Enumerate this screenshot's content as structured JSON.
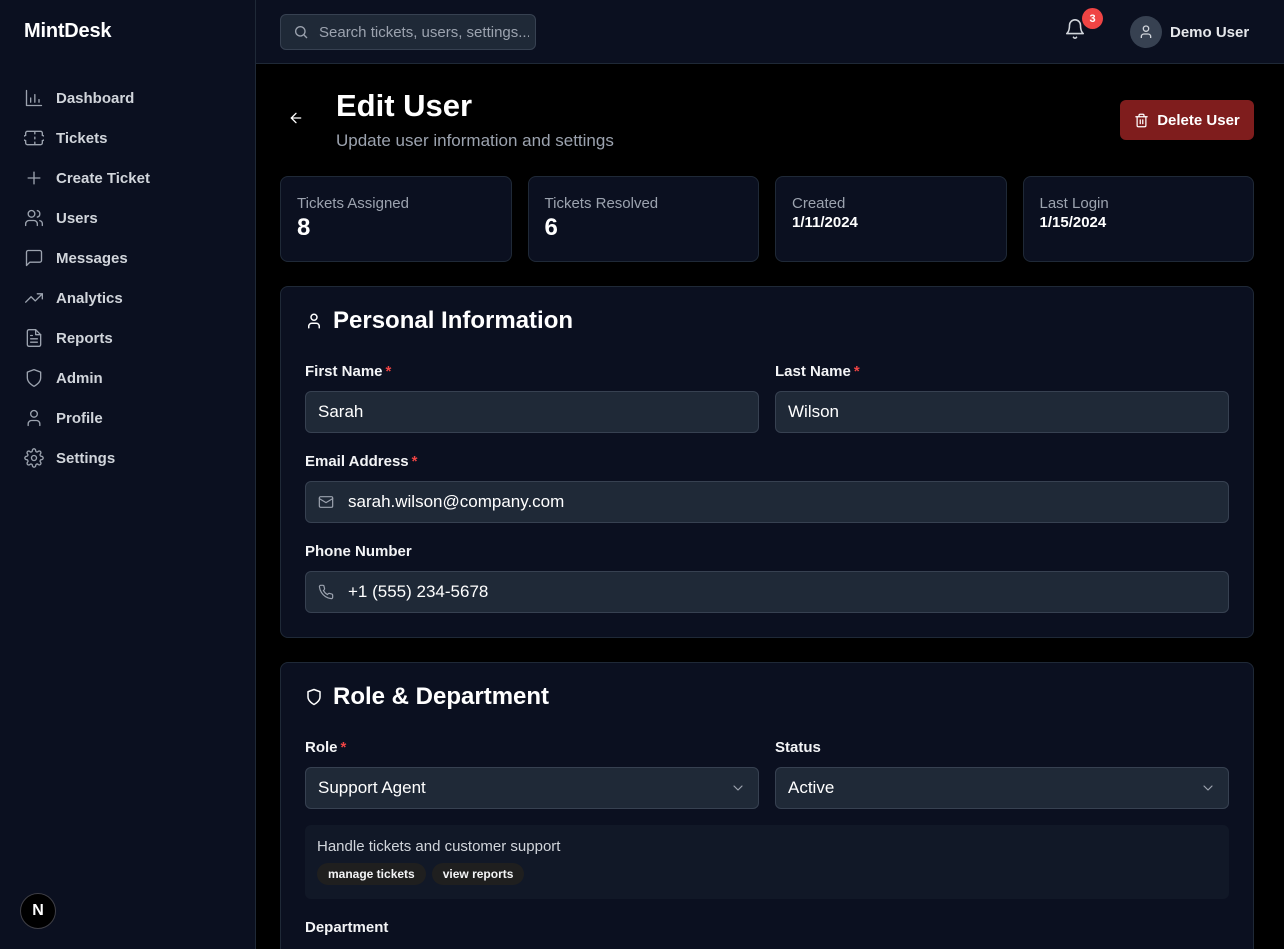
{
  "app": {
    "name": "MintDesk"
  },
  "sidebar": {
    "items": [
      {
        "label": "Dashboard",
        "icon": "bar-chart-icon"
      },
      {
        "label": "Tickets",
        "icon": "ticket-icon"
      },
      {
        "label": "Create Ticket",
        "icon": "plus-icon"
      },
      {
        "label": "Users",
        "icon": "users-icon"
      },
      {
        "label": "Messages",
        "icon": "message-icon"
      },
      {
        "label": "Analytics",
        "icon": "trending-up-icon"
      },
      {
        "label": "Reports",
        "icon": "file-text-icon"
      },
      {
        "label": "Admin",
        "icon": "shield-icon"
      },
      {
        "label": "Profile",
        "icon": "user-icon"
      },
      {
        "label": "Settings",
        "icon": "gear-icon"
      }
    ],
    "badge": "N"
  },
  "header": {
    "search_placeholder": "Search tickets, users, settings...",
    "notification_count": "3",
    "user_name": "Demo User"
  },
  "page": {
    "title": "Edit User",
    "subtitle": "Update user information and settings",
    "delete_label": "Delete User"
  },
  "stats": [
    {
      "label": "Tickets Assigned",
      "value": "8"
    },
    {
      "label": "Tickets Resolved",
      "value": "6"
    },
    {
      "label": "Created",
      "value": "1/11/2024"
    },
    {
      "label": "Last Login",
      "value": "1/15/2024"
    }
  ],
  "personal": {
    "title": "Personal Information",
    "first_name_label": "First Name",
    "first_name": "Sarah",
    "last_name_label": "Last Name",
    "last_name": "Wilson",
    "email_label": "Email Address",
    "email": "sarah.wilson@company.com",
    "phone_label": "Phone Number",
    "phone": "+1 (555) 234-5678",
    "required_mark": "*"
  },
  "role": {
    "title": "Role & Department",
    "role_label": "Role",
    "role_value": "Support Agent",
    "status_label": "Status",
    "status_value": "Active",
    "description": "Handle tickets and customer support",
    "permissions": [
      "manage tickets",
      "view reports"
    ],
    "department_label": "Department"
  },
  "colors": {
    "accent_danger": "#7f1d1d",
    "badge_red": "#ef4444",
    "required": "#ef4444"
  }
}
